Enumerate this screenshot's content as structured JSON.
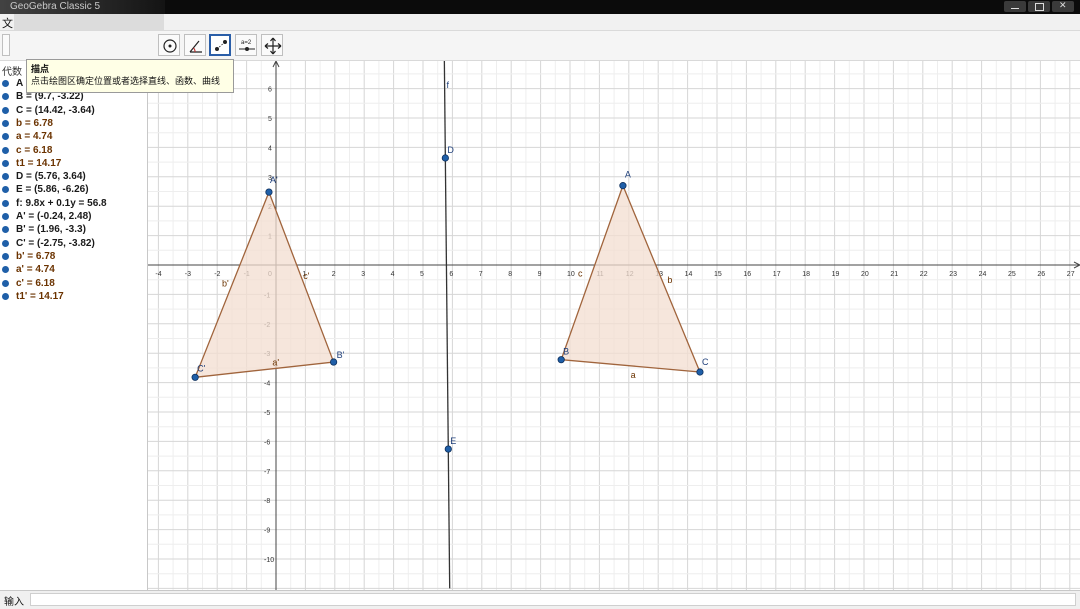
{
  "window": {
    "title": "GeoGebra Classic 5"
  },
  "menubar": {
    "first_item": "文"
  },
  "tooltip": {
    "title": "描点",
    "description": "点击绘图区确定位置或者选择直线、函数、曲线"
  },
  "algebra": {
    "header": "代数",
    "rows": [
      {
        "text": "A = ",
        "color": "blue"
      },
      {
        "text": "B = (9.7, -3.22)",
        "color": "blue"
      },
      {
        "text": "C = (14.42, -3.64)",
        "color": "blue"
      },
      {
        "text": "b = 6.78",
        "color": "brown"
      },
      {
        "text": "a = 4.74",
        "color": "brown"
      },
      {
        "text": "c = 6.18",
        "color": "brown"
      },
      {
        "text": "t1 = 14.17",
        "color": "brown"
      },
      {
        "text": "D = (5.76, 3.64)",
        "color": "blue"
      },
      {
        "text": "E = (5.86, -6.26)",
        "color": "blue"
      },
      {
        "text": "f: 9.8x + 0.1y = 56.8",
        "color": "black"
      },
      {
        "text": "A' = (-0.24, 2.48)",
        "color": "blue"
      },
      {
        "text": "B' = (1.96, -3.3)",
        "color": "blue"
      },
      {
        "text": "C' = (-2.75, -3.82)",
        "color": "blue"
      },
      {
        "text": "b' = 6.78",
        "color": "brown"
      },
      {
        "text": "a' = 4.74",
        "color": "brown"
      },
      {
        "text": "c' = 6.18",
        "color": "brown"
      },
      {
        "text": "t1' = 14.17",
        "color": "brown"
      }
    ]
  },
  "graphics": {
    "x_ticks": [
      "-4",
      "-3",
      "-2",
      "-1",
      "0",
      "1",
      "2",
      "3",
      "4",
      "5",
      "6",
      "7",
      "8",
      "9",
      "10",
      "11",
      "12",
      "13",
      "14",
      "15",
      "16",
      "17",
      "18",
      "19",
      "20",
      "21",
      "22",
      "23",
      "24",
      "25",
      "26",
      "27"
    ],
    "y_ticks": [
      "6",
      "5",
      "4",
      "3",
      "2",
      "1",
      "-1",
      "-2",
      "-3",
      "-4",
      "-5",
      "-6",
      "-7",
      "-8",
      "-9",
      "-10"
    ],
    "points": {
      "A": [
        11.8,
        2.7
      ],
      "B": [
        9.7,
        -3.22
      ],
      "C": [
        14.42,
        -3.64
      ],
      "A'": [
        -0.24,
        2.48
      ],
      "B'": [
        1.96,
        -3.3
      ],
      "C'": [
        -2.75,
        -3.82
      ],
      "D": [
        5.76,
        3.64
      ],
      "E": [
        5.86,
        -6.26
      ]
    },
    "point_labels": {
      "A": "A",
      "B": "B",
      "C": "C",
      "A'": "A'",
      "B'": "B'",
      "C'": "C'",
      "D": "D",
      "E": "E"
    },
    "segment_labels": {
      "a": "a",
      "b": "b",
      "c": "c",
      "a'": "a'",
      "b'": "b'",
      "c'": "c'"
    },
    "line_label": "f",
    "colors": {
      "fill": "#f3ddd0",
      "edge": "#a0643c",
      "point": "#1f5fa8",
      "grid": "#dcdcdc",
      "axis": "#444444"
    }
  },
  "inputbar": {
    "label": "输入"
  }
}
